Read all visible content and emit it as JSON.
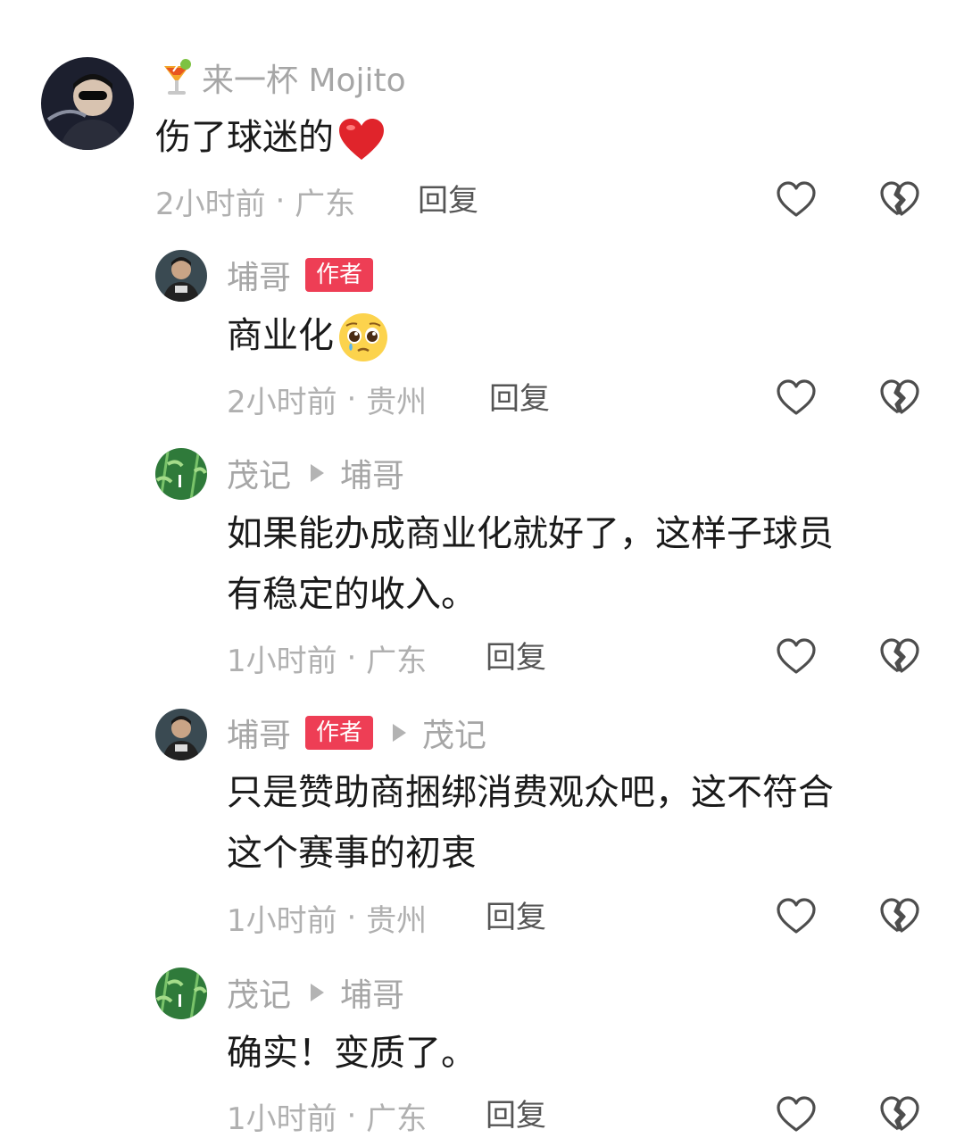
{
  "comments": [
    {
      "author": "来一杯 Mojito",
      "author_emoji": "cocktail-emoji",
      "text": "伤了球迷的",
      "text_emoji": "red-heart-emoji",
      "time": "2小时前",
      "location": "广东",
      "reply_label": "回复"
    },
    {
      "author": "埔哥",
      "badge": "作者",
      "text": "商业化",
      "text_emoji": "pleading-face-emoji",
      "time": "2小时前",
      "location": "贵州",
      "reply_label": "回复"
    },
    {
      "author": "茂记",
      "reply_to": "埔哥",
      "text_lines": [
        "如果能办成商业化就好了，这样子球员",
        "有稳定的收入。"
      ],
      "time": "1小时前",
      "location": "广东",
      "reply_label": "回复"
    },
    {
      "author": "埔哥",
      "badge": "作者",
      "reply_to": "茂记",
      "text_lines": [
        "只是赞助商捆绑消费观众吧，这不符合",
        "这个赛事的初衷"
      ],
      "time": "1小时前",
      "location": "贵州",
      "reply_label": "回复"
    },
    {
      "author": "茂记",
      "reply_to": "埔哥",
      "text": "确实！变质了。",
      "time": "1小时前",
      "location": "广东",
      "reply_label": "回复"
    }
  ],
  "meta_separator": " · ",
  "icons": {
    "like": "heart-outline-icon",
    "dislike": "broken-heart-outline-icon"
  },
  "colors": {
    "badge": "#ee3e55",
    "secondary_text": "#a6a6a6",
    "primary_text": "#1a1a1a"
  }
}
